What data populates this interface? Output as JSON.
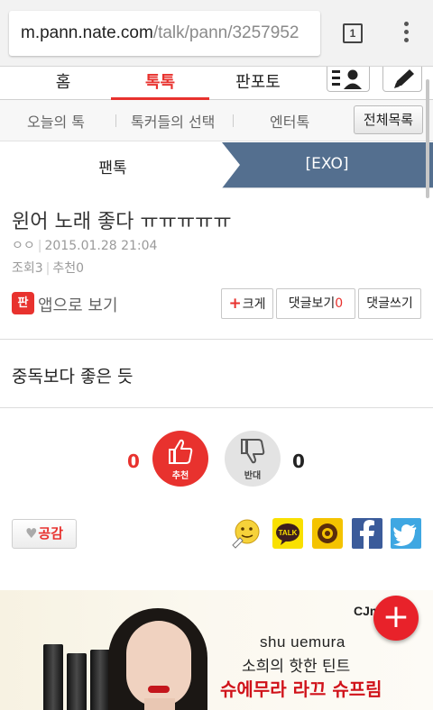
{
  "browser": {
    "url_host": "m.pann.nate.com",
    "url_path": "/talk/pann/3257952",
    "tab_count": "1",
    "tab_switcher_icon": "tab-count-icon",
    "menu_icon": "overflow-menu-icon"
  },
  "nav": {
    "tabs": [
      {
        "label": "홈",
        "active": false
      },
      {
        "label": "톡톡",
        "active": true
      },
      {
        "label": "판포토",
        "active": false
      }
    ],
    "profile_icon": "profile-list-icon",
    "write_icon": "pencil-icon",
    "accent_color": "#e8322e"
  },
  "subnav": {
    "items": [
      "오늘의 톡",
      "톡커들의 선택",
      "엔터톡"
    ],
    "all_list_label": "전체목록"
  },
  "breadcrumb": {
    "category": "팬톡",
    "board": "[EXO]"
  },
  "post": {
    "title": "윈어 노래 좋다 ㅠㅠㅠㅠㅠ",
    "author": "ㅇㅇ",
    "date": "2015.01.28 21:04",
    "views_label": "조회3",
    "recommend_label": "추천0",
    "body": "중독보다 좋은 듯"
  },
  "actions": {
    "app_icon_text": "판",
    "app_view_label": "앱으로 보기",
    "zoom_label": "크게",
    "view_comments_label": "댓글보기",
    "comment_count": "0",
    "write_comment_label": "댓글쓰기"
  },
  "vote": {
    "up_count": "0",
    "up_label": "추천",
    "down_count": "0",
    "down_label": "반대"
  },
  "share": {
    "empathy_label": "공감",
    "icons": [
      "emoticon-share-icon",
      "kakaotalk-icon",
      "kakaostory-icon",
      "facebook-icon",
      "twitter-icon"
    ],
    "talk_text": "TALK"
  },
  "ad": {
    "logo": "CJm",
    "brand": "shu uemura",
    "line1": "소희의 핫한 틴트",
    "line2": "슈에무라 라끄 슈프림"
  },
  "fab_label": "+"
}
